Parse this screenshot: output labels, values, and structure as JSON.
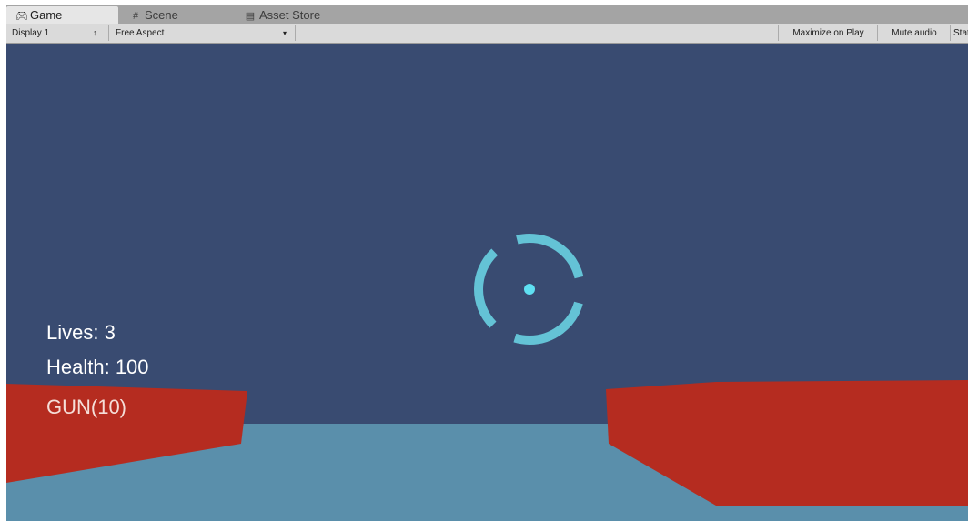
{
  "tabs": [
    {
      "label": "Game",
      "icon": "game-controller-icon",
      "active": true
    },
    {
      "label": "Scene",
      "icon": "scene-grid-icon",
      "active": false
    },
    {
      "label": "Asset Store",
      "icon": "asset-store-icon",
      "active": false
    }
  ],
  "toolbar": {
    "display": "Display 1",
    "aspect": "Free Aspect",
    "maximize_on_play": "Maximize on Play",
    "mute_audio": "Mute audio",
    "stats": "Stats"
  },
  "hud": {
    "lives": "Lives: 3",
    "health": "Health: 100",
    "weapon": "GUN(10)"
  },
  "colors": {
    "sky": "#394b71",
    "floor": "#5a8fab",
    "walls": "#b52c20",
    "crosshair": "#64c3d6",
    "crosshair_dot": "#5fe0f2",
    "hud_text": "#ffffff"
  }
}
